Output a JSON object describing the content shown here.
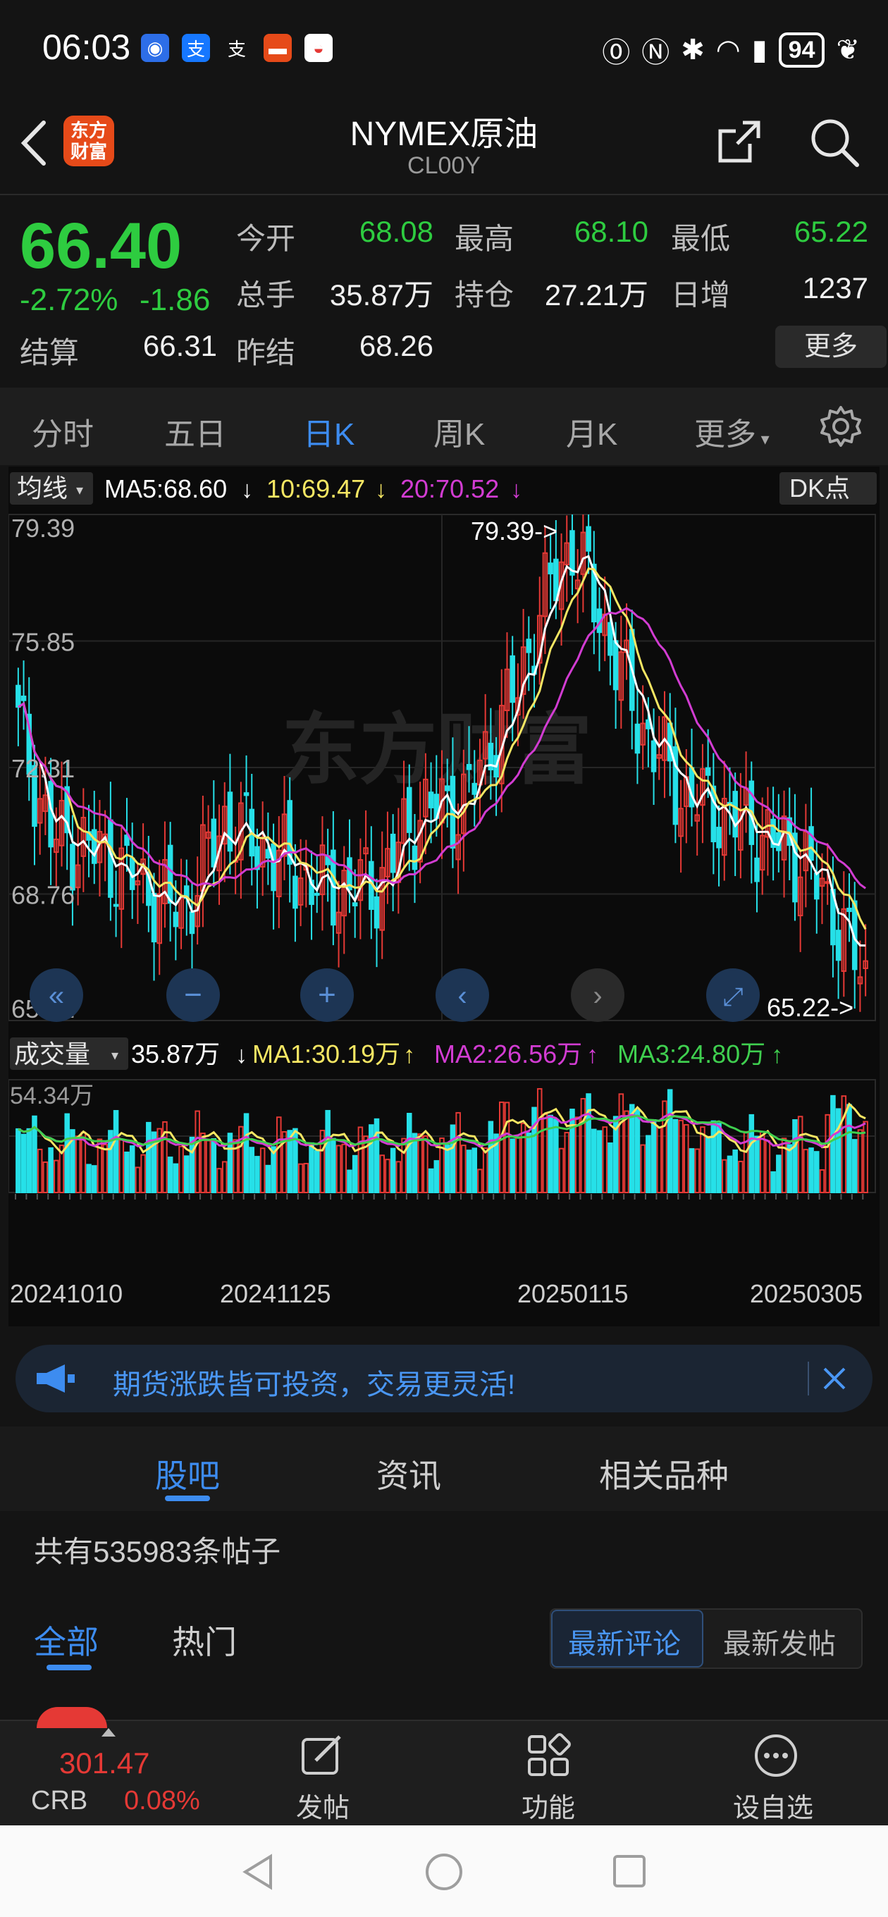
{
  "status": {
    "time": "06:03",
    "battery": "94"
  },
  "header": {
    "title": "NYMEX原油",
    "code": "CL00Y",
    "logo_text": "东方财富",
    "back_icon": "back-arrow-icon",
    "share_icon": "share-icon",
    "search_icon": "search-icon"
  },
  "quote": {
    "price": "66.40",
    "change_pct": "-2.72%",
    "change": "-1.86",
    "labels": {
      "open": "今开",
      "high": "最高",
      "low": "最低",
      "volume": "总手",
      "position": "持仓",
      "daily_inc": "日增",
      "settle": "结算",
      "prev_settle": "昨结"
    },
    "values": {
      "open": "68.08",
      "high": "68.10",
      "low": "65.22",
      "volume": "35.87万",
      "position": "27.21万",
      "daily_inc": "1237",
      "settle": "66.31",
      "prev_settle": "68.26"
    },
    "more": "更多"
  },
  "tabs": [
    "分时",
    "五日",
    "日K",
    "周K",
    "月K",
    "更多"
  ],
  "settings_icon": "gear-icon",
  "chart_data": {
    "type": "candlestick",
    "ma_selector": "均线",
    "ma5": "MA5:68.60",
    "ma10": "10:69.47",
    "ma20": "20:70.52",
    "dk": "DK点",
    "y_ticks": [
      "79.39",
      "75.85",
      "72.31",
      "68.76",
      "65.22"
    ],
    "ylim": [
      65.22,
      79.39
    ],
    "max_marker": "79.39->",
    "min_marker": "65.22->",
    "volume_label": "成交量",
    "volume_value": "35.87万",
    "vol_ma1": "MA1:30.19万",
    "vol_ma2": "MA2:26.56万",
    "vol_ma3": "MA3:24.80万",
    "vol_max": "54.34万",
    "x_ticks": [
      "20241010",
      "20241125",
      "20250115",
      "20250305"
    ],
    "colors": {
      "up": "#e53935",
      "down": "#26e0e8",
      "ma5": "#ffffff",
      "ma10": "#f5e663",
      "ma20": "#d23cd2",
      "ma3": "#3fcf4f"
    },
    "watermark": "东方财富"
  },
  "banner": {
    "text": "期货涨跌皆可投资，交易更灵活!",
    "icon": "megaphone-icon"
  },
  "sections": [
    "股吧",
    "资讯",
    "相关品种"
  ],
  "post_count": "共有535983条帖子",
  "filters": {
    "all": "全部",
    "hot": "热门",
    "latest_comment": "最新评论",
    "latest_post": "最新发帖"
  },
  "bottom": {
    "crb_price": "301.47",
    "crb_label": "CRB",
    "crb_pct": "0.08%",
    "post": "发帖",
    "func": "功能",
    "watch": "设自选"
  }
}
